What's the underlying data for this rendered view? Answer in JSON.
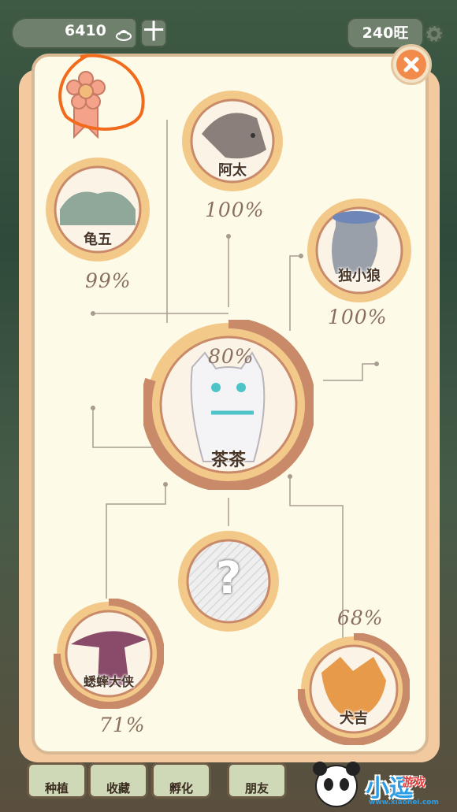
{
  "top_bar": {
    "coins": "6410",
    "plus_label": "十",
    "wang": "240旺"
  },
  "characters": [
    {
      "name": "阿太",
      "percent": "100%",
      "progress": 1.0
    },
    {
      "name": "龟五",
      "percent": "99%",
      "progress": 0.99
    },
    {
      "name": "独小狼",
      "percent": "100%",
      "progress": 1.0
    },
    {
      "name": "茶茶",
      "percent": "80%",
      "progress": 0.8
    },
    {
      "name": "",
      "percent": "",
      "progress": 0,
      "locked_symbol": "?"
    },
    {
      "name": "蟋蟀大侠",
      "percent": "71%",
      "progress": 0.71
    },
    {
      "name": "犬吉",
      "percent": "68%",
      "progress": 0.68
    }
  ],
  "bottom_tabs": [
    "种植",
    "收藏",
    "孵化",
    "朋友"
  ],
  "watermark": {
    "text": "小逗",
    "sub": "游戏",
    "url": "www.xiaohei.com"
  },
  "colors": {
    "ring_fill": "#f3c98a",
    "ring_progress": "#c98a6a",
    "panel": "#fdfbe8",
    "close": "#f28a4b",
    "badge": "#f4a38a",
    "annotation": "#f26b1d"
  }
}
